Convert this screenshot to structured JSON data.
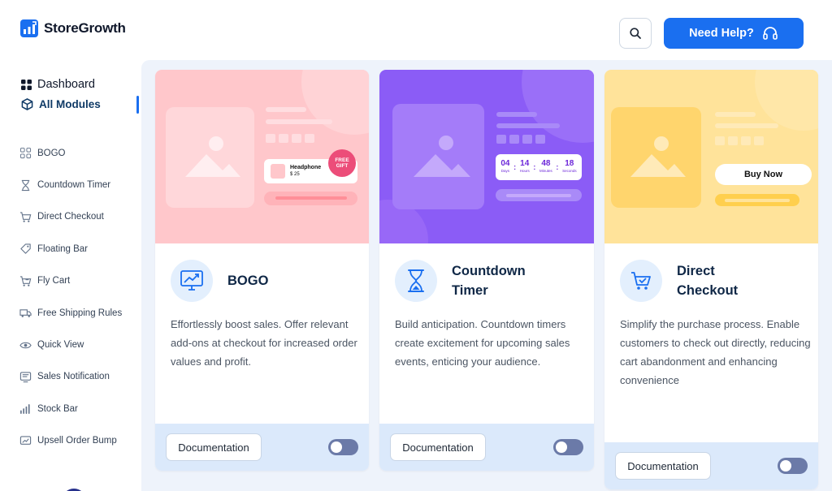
{
  "header": {
    "brand": "StoreGrowth",
    "help_label": "Need Help?"
  },
  "icons": {
    "search": "search-icon",
    "headset": "headset-icon",
    "dashboard": "grid-icon",
    "modules": "cube-icon"
  },
  "colors": {
    "primary": "#1a6ff0",
    "bogo_hero": "#ffc7cb",
    "countdown_hero": "#8b5cf6",
    "checkout_hero": "#ffe39a",
    "card_footer": "#dbe9fb"
  },
  "sidebar": {
    "dashboard": "Dashboard",
    "all_modules": "All Modules",
    "modules": [
      {
        "label": "BOGO",
        "icon": "bogo-icon"
      },
      {
        "label": "Countdown Timer",
        "icon": "hourglass-icon"
      },
      {
        "label": "Direct Checkout",
        "icon": "cart-icon"
      },
      {
        "label": "Floating Bar",
        "icon": "tag-icon"
      },
      {
        "label": "Fly Cart",
        "icon": "fly-cart-icon"
      },
      {
        "label": "Free Shipping Rules",
        "icon": "truck-icon"
      },
      {
        "label": "Quick View",
        "icon": "eye-icon"
      },
      {
        "label": "Sales Notification",
        "icon": "notification-icon"
      },
      {
        "label": "Stock Bar",
        "icon": "stock-bar-icon"
      },
      {
        "label": "Upsell Order Bump",
        "icon": "upsell-icon"
      }
    ]
  },
  "cards": [
    {
      "title": "BOGO",
      "icon": "monitor-chart-icon",
      "description": "Effortlessly boost sales. Offer relevant add-ons at checkout for increased order values and profit.",
      "doc_label": "Documentation",
      "enabled": false,
      "hero": {
        "product_name": "Headphone",
        "product_price": "$ 25",
        "badge": "FREE GIFT"
      }
    },
    {
      "title": "Countdown Timer",
      "icon": "hourglass-icon",
      "description": "Build anticipation. Countdown timers create excitement for upcoming sales events, enticing your audience.",
      "doc_label": "Documentation",
      "enabled": false,
      "hero": {
        "timer": [
          {
            "value": "04",
            "unit": "Days"
          },
          {
            "value": "14",
            "unit": "Hours"
          },
          {
            "value": "48",
            "unit": "Minutes"
          },
          {
            "value": "18",
            "unit": "Seconds"
          }
        ]
      }
    },
    {
      "title": "Direct Checkout",
      "icon": "cart-check-icon",
      "description": "Simplify the purchase process. Enable customers to check out directly, reducing cart abandonment and enhancing convenience",
      "doc_label": "Documentation",
      "enabled": false,
      "hero": {
        "buy_label": "Buy Now"
      }
    }
  ]
}
